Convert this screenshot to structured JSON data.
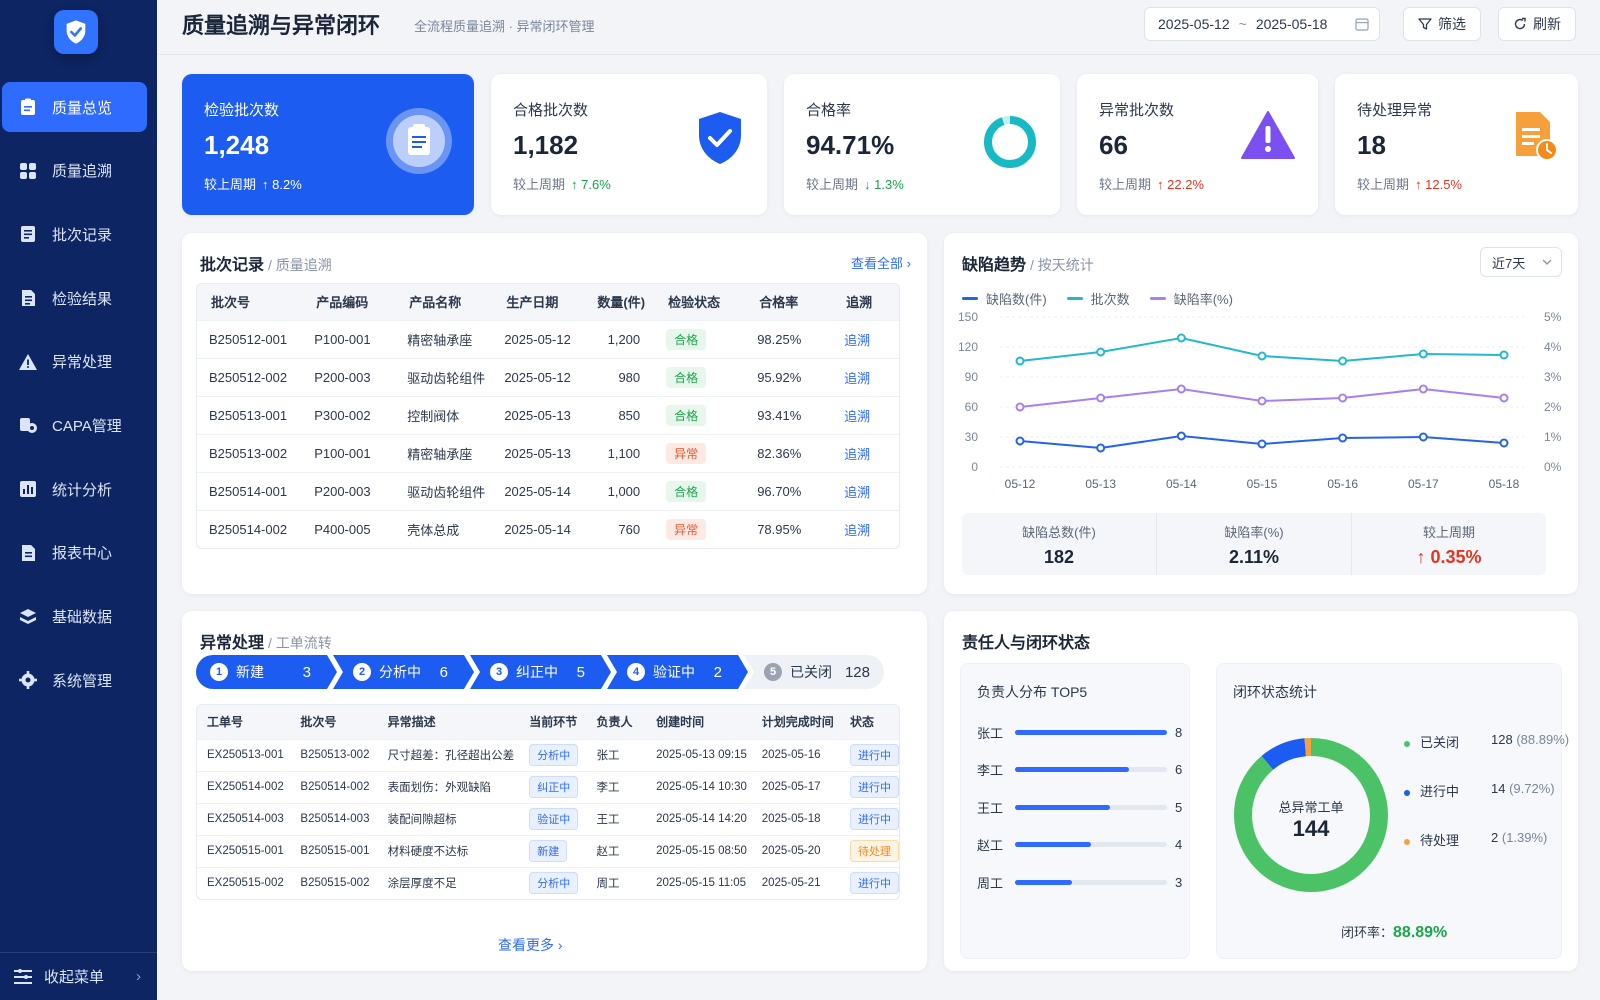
{
  "sidebar": {
    "items": [
      {
        "label": "质量总览",
        "icon": "clipboard-icon",
        "active": true
      },
      {
        "label": "质量追溯",
        "icon": "grid-icon",
        "active": false
      },
      {
        "label": "批次记录",
        "icon": "document-icon",
        "active": false
      },
      {
        "label": "检验结果",
        "icon": "checklist-icon",
        "active": false
      },
      {
        "label": "异常处理",
        "icon": "warning-icon",
        "active": false
      },
      {
        "label": "CAPA管理",
        "icon": "gears-icon",
        "active": false
      },
      {
        "label": "统计分析",
        "icon": "chart-icon",
        "active": false
      },
      {
        "label": "报表中心",
        "icon": "report-icon",
        "active": false
      },
      {
        "label": "基础数据",
        "icon": "layers-icon",
        "active": false
      },
      {
        "label": "系统管理",
        "icon": "gear-icon",
        "active": false
      }
    ],
    "collapse_label": "收起菜单"
  },
  "header": {
    "title": "质量追溯与异常闭环",
    "subtitle": "全流程质量追溯 · 异常闭环管理",
    "date_start": "2025-05-12",
    "date_sep": "~",
    "date_end": "2025-05-18",
    "filter_label": "筛选",
    "refresh_label": "刷新"
  },
  "kpis": [
    {
      "label": "检验批次数",
      "value": "1,248",
      "cmp_label": "较上周期",
      "change": "↑ 8.2%",
      "trend": "up-white"
    },
    {
      "label": "合格批次数",
      "value": "1,182",
      "cmp_label": "较上周期",
      "change": "↑ 7.6%",
      "trend": "up-green"
    },
    {
      "label": "合格率",
      "value": "94.71%",
      "cmp_label": "较上周期",
      "change": "↓ 1.3%",
      "trend": "down-green"
    },
    {
      "label": "异常批次数",
      "value": "66",
      "cmp_label": "较上周期",
      "change": "↑ 22.2%",
      "trend": "up-red"
    },
    {
      "label": "待处理异常",
      "value": "18",
      "cmp_label": "较上周期",
      "change": "↑ 12.5%",
      "trend": "up-red"
    }
  ],
  "batch": {
    "title": "批次记录",
    "subtitle": "/ 质量追溯",
    "view_all": "查看全部",
    "columns": [
      "批次号",
      "产品编码",
      "产品名称",
      "生产日期",
      "数量(件)",
      "检验状态",
      "合格率",
      "追溯"
    ],
    "rows": [
      {
        "batch": "B250512-001",
        "code": "P100-001",
        "name": "精密轴承座",
        "date": "2025-05-12",
        "qty": "1,200",
        "status": "合格",
        "ok": true,
        "rate": "98.25%",
        "action": "追溯"
      },
      {
        "batch": "B250512-002",
        "code": "P200-003",
        "name": "驱动齿轮组件",
        "date": "2025-05-12",
        "qty": "980",
        "status": "合格",
        "ok": true,
        "rate": "95.92%",
        "action": "追溯"
      },
      {
        "batch": "B250513-001",
        "code": "P300-002",
        "name": "控制阀体",
        "date": "2025-05-13",
        "qty": "850",
        "status": "合格",
        "ok": true,
        "rate": "93.41%",
        "action": "追溯"
      },
      {
        "batch": "B250513-002",
        "code": "P100-001",
        "name": "精密轴承座",
        "date": "2025-05-13",
        "qty": "1,100",
        "status": "异常",
        "ok": false,
        "rate": "82.36%",
        "action": "追溯"
      },
      {
        "batch": "B250514-001",
        "code": "P200-003",
        "name": "驱动齿轮组件",
        "date": "2025-05-14",
        "qty": "1,000",
        "status": "合格",
        "ok": true,
        "rate": "96.70%",
        "action": "追溯"
      },
      {
        "batch": "B250514-002",
        "code": "P400-005",
        "name": "壳体总成",
        "date": "2025-05-14",
        "qty": "760",
        "status": "异常",
        "ok": false,
        "rate": "78.95%",
        "action": "追溯"
      }
    ]
  },
  "trend": {
    "title": "缺陷趋势",
    "subtitle": "/ 按天统计",
    "range": "近7天",
    "summary": [
      {
        "label": "缺陷总数(件)",
        "value": "182"
      },
      {
        "label": "缺陷率(%)",
        "value": "2.11%"
      },
      {
        "label": "较上周期",
        "value": "↑ 0.35%"
      }
    ]
  },
  "chart_data": {
    "type": "line",
    "x": [
      "05-12",
      "05-13",
      "05-14",
      "05-15",
      "05-16",
      "05-17",
      "05-18"
    ],
    "series": [
      {
        "name": "缺陷数(件)",
        "axis": "left",
        "color": "#2563eb",
        "values": [
          26,
          19,
          31,
          23,
          29,
          30,
          24
        ]
      },
      {
        "name": "批次数",
        "axis": "left",
        "color": "#22b8cf",
        "values": [
          106,
          115,
          129,
          111,
          106,
          113,
          112
        ]
      },
      {
        "name": "缺陷率(%)",
        "axis": "right",
        "color": "#a87ef0",
        "values": [
          2.0,
          2.3,
          2.6,
          2.2,
          2.3,
          2.6,
          2.3
        ]
      }
    ],
    "ylim_left": [
      0,
      150
    ],
    "yticks_left": [
      "150",
      "120",
      "90",
      "60",
      "30",
      "0"
    ],
    "ylim_right": [
      0,
      5
    ],
    "yticks_right": [
      "5%",
      "4%",
      "3%",
      "2%",
      "1%",
      "0%"
    ],
    "legend": "top-left",
    "grid": true
  },
  "exceptions": {
    "title": "异常处理",
    "subtitle": "/ 工单流转",
    "steps": [
      {
        "num": "1",
        "label": "新建",
        "count": "3",
        "active": true
      },
      {
        "num": "2",
        "label": "分析中",
        "count": "6",
        "active": true
      },
      {
        "num": "3",
        "label": "纠正中",
        "count": "5",
        "active": true
      },
      {
        "num": "4",
        "label": "验证中",
        "count": "2",
        "active": true
      },
      {
        "num": "5",
        "label": "已关闭",
        "count": "128",
        "active": false
      }
    ],
    "columns": [
      "工单号",
      "批次号",
      "异常描述",
      "当前环节",
      "负责人",
      "创建时间",
      "计划完成时间",
      "状态"
    ],
    "rows": [
      {
        "id": "EX250513-001",
        "batch": "B250513-002",
        "desc": "尺寸超差：孔径超出公差",
        "stage": "分析中",
        "owner": "张工",
        "created": "2025-05-13 09:15",
        "due": "2025-05-16",
        "status": "进行中",
        "warn": false
      },
      {
        "id": "EX250514-002",
        "batch": "B250514-002",
        "desc": "表面划伤：外观缺陷",
        "stage": "纠正中",
        "owner": "李工",
        "created": "2025-05-14 10:30",
        "due": "2025-05-17",
        "status": "进行中",
        "warn": false
      },
      {
        "id": "EX250514-003",
        "batch": "B250514-003",
        "desc": "装配间隙超标",
        "stage": "验证中",
        "owner": "王工",
        "created": "2025-05-14 14:20",
        "due": "2025-05-18",
        "status": "进行中",
        "warn": false
      },
      {
        "id": "EX250515-001",
        "batch": "B250515-001",
        "desc": "材料硬度不达标",
        "stage": "新建",
        "owner": "赵工",
        "created": "2025-05-15 08:50",
        "due": "2025-05-20",
        "status": "待处理",
        "warn": true
      },
      {
        "id": "EX250515-002",
        "batch": "B250515-002",
        "desc": "涂层厚度不足",
        "stage": "分析中",
        "owner": "周工",
        "created": "2025-05-15 11:05",
        "due": "2025-05-21",
        "status": "进行中",
        "warn": false
      }
    ],
    "more": "查看更多"
  },
  "owners": {
    "title": "责任人与闭环状态",
    "top_title": "负责人分布 TOP5",
    "max": 8,
    "people": [
      {
        "name": "张工",
        "count": 8
      },
      {
        "name": "李工",
        "count": 6
      },
      {
        "name": "王工",
        "count": 5
      },
      {
        "name": "赵工",
        "count": 4
      },
      {
        "name": "周工",
        "count": 3
      }
    ],
    "closure_title": "闭环状态统计",
    "donut_label": "总异常工单",
    "donut_total": "144",
    "states": [
      {
        "label": "已关闭",
        "count": "128",
        "pct": "(88.89%)",
        "value": 128,
        "color": "#4cc266"
      },
      {
        "label": "进行中",
        "count": "14",
        "pct": "(9.72%)",
        "value": 14,
        "color": "#1c5cf0"
      },
      {
        "label": "待处理",
        "count": "2",
        "pct": "(1.39%)",
        "value": 2,
        "color": "#f5a03a"
      }
    ],
    "closure_rate_label": "闭环率：",
    "closure_rate": "88.89%"
  }
}
